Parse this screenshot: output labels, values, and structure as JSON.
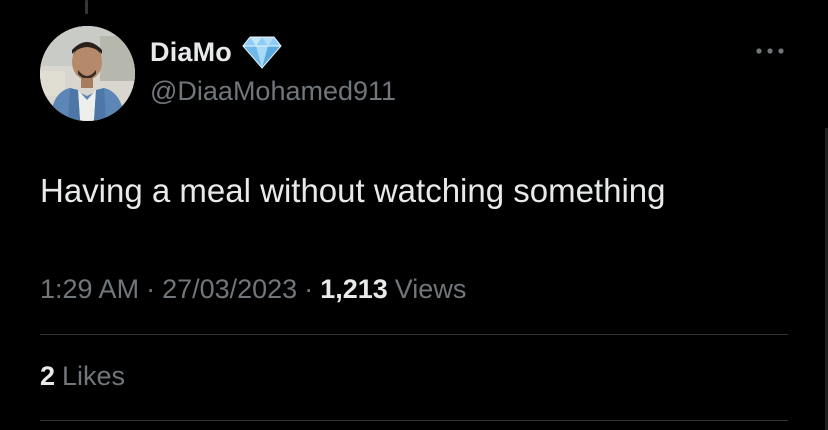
{
  "tweet": {
    "author": {
      "display_name": "DiaMo",
      "handle": "@DiaaMohamed911",
      "badge_icon": "diamond-icon",
      "avatar_icon": "avatar"
    },
    "more_icon": "more-icon",
    "text": "Having a meal without watching something",
    "meta": {
      "time": "1:29 AM",
      "separator": "·",
      "date": "27/03/2023",
      "views_count": "1,213",
      "views_label": "Views"
    },
    "stats": {
      "likes_count": "2",
      "likes_label": "Likes"
    }
  },
  "colors": {
    "background": "#000000",
    "primary_text": "#e7e9ea",
    "secondary_text": "#71767b",
    "divider": "#2f3336",
    "badge": "#8ecdf5"
  }
}
